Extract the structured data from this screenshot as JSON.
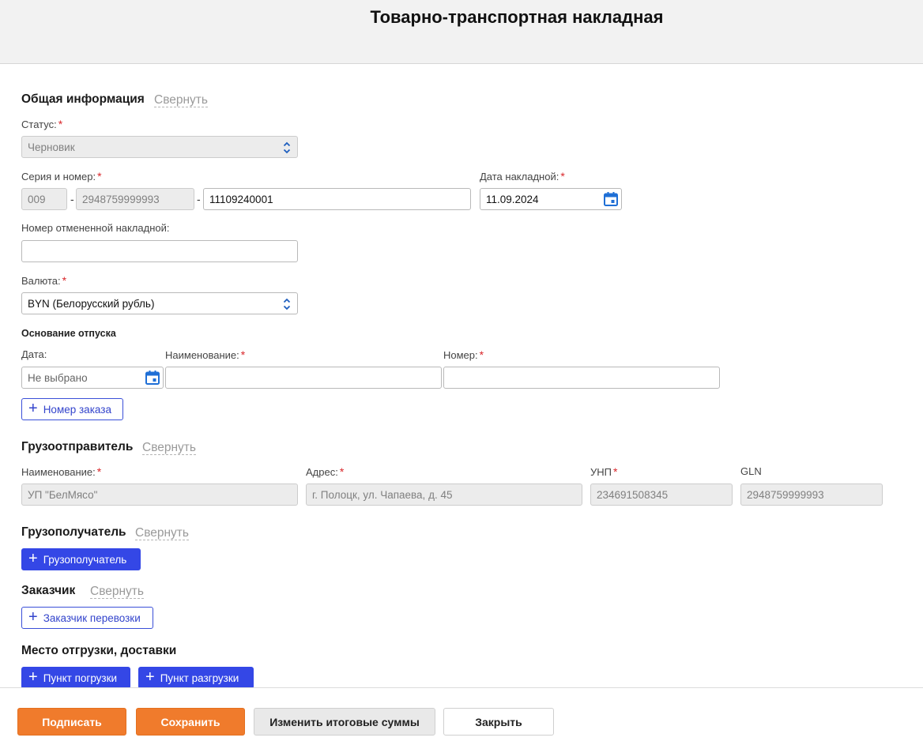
{
  "page": {
    "title": "Товарно-транспортная накладная"
  },
  "general": {
    "title": "Общая информация",
    "collapse": "Свернуть",
    "status_label": "Статус:",
    "status_value": "Черновик",
    "series_label": "Серия и номер:",
    "series_part1": "009",
    "series_part2": "2948759999993",
    "series_part3": "11109240001",
    "date_label": "Дата накладной:",
    "date_value": "11.09.2024",
    "cancelled_label": "Номер отмененной накладной:",
    "cancelled_value": "",
    "currency_label": "Валюта:",
    "currency_value": "BYN (Белорусский рубль)",
    "basis_title": "Основание отпуска",
    "basis_date_label": "Дата:",
    "basis_date_placeholder": "Не выбрано",
    "basis_name_label": "Наименование:",
    "basis_name_value": "",
    "basis_number_label": "Номер:",
    "basis_number_value": "",
    "order_button": "Номер заказа"
  },
  "shipper": {
    "title": "Грузоотправитель",
    "collapse": "Свернуть",
    "name_label": "Наименование:",
    "name_value": "УП \"БелМясо\"",
    "address_label": "Адрес:",
    "address_value": "г. Полоцк, ул. Чапаева, д. 45",
    "unp_label": "УНП",
    "unp_value": "234691508345",
    "gln_label": "GLN",
    "gln_value": "2948759999993"
  },
  "consignee": {
    "title": "Грузополучатель",
    "collapse": "Свернуть",
    "add_button": "Грузополучатель"
  },
  "customer": {
    "title": "Заказчик",
    "collapse": "Свернуть",
    "add_button": "Заказчик перевозки"
  },
  "places": {
    "title": "Место отгрузки, доставки",
    "loading_button": "Пункт погрузки",
    "unloading_button": "Пункт разгрузки"
  },
  "footer": {
    "sign": "Подписать",
    "save": "Сохранить",
    "change_totals": "Изменить итоговые суммы",
    "close": "Закрыть"
  },
  "colors": {
    "accent_blue": "#3447e6",
    "orange": "#f07b2c",
    "required": "#d9262a",
    "calendar_icon": "#1f6fd6"
  },
  "icons": {
    "select": "chevron-up-down-icon",
    "calendar": "calendar-icon",
    "add": "plus-icon"
  }
}
